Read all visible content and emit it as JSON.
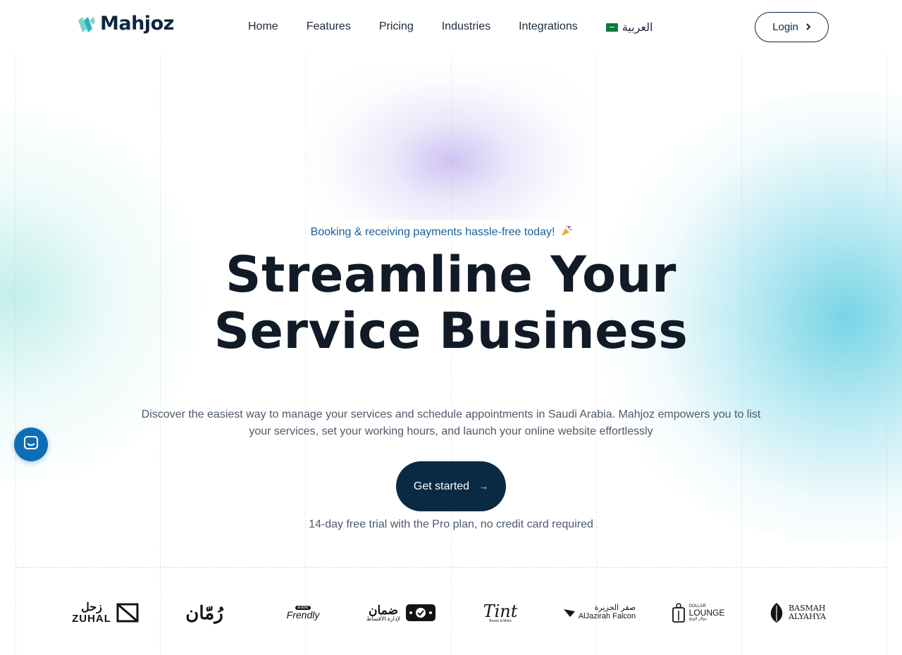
{
  "brand": {
    "name": "Mahjoz"
  },
  "nav": {
    "items": [
      {
        "label": "Home"
      },
      {
        "label": "Features"
      },
      {
        "label": "Pricing"
      },
      {
        "label": "Industries"
      },
      {
        "label": "Integrations"
      }
    ],
    "language": {
      "label": "العربية",
      "flag_icon": "saudi-flag-icon"
    },
    "login_label": "Login"
  },
  "hero": {
    "badge_text": "Booking & receiving payments hassle-free today!",
    "badge_icon": "party-popper-icon",
    "headline_line1": "Streamline Your",
    "headline_line2": "Service Business",
    "subtext": "Discover the easiest way to manage your services and schedule appointments in Saudi Arabia. Mahjoz empowers you to list your services, set your working hours, and launch your online website effortlessly",
    "cta_label": "Get started",
    "trial_note": "14-day free trial with the Pro plan, no credit card required"
  },
  "client_logos": [
    {
      "name": "ZUHAL",
      "arabic": "زحل"
    },
    {
      "name": "",
      "arabic": "رُمّان"
    },
    {
      "name": "Frendly",
      "arabic": "",
      "tag": "arabic"
    },
    {
      "name": "لإدارة الأقساط",
      "arabic": "ضمان"
    },
    {
      "name": "Tint",
      "arabic": "",
      "tag": "Brows & More"
    },
    {
      "name": "AlJazirah Falcon",
      "arabic": "صقر الجزيرة"
    },
    {
      "name": "LOUNGE",
      "arabic": "دولار لاونج",
      "tag": "DOLLAR"
    },
    {
      "name": "BASMAH",
      "arabic": "",
      "tag": "ALYAHYA"
    }
  ],
  "colors": {
    "primary": "#0a2a44",
    "link": "#1b5f9a",
    "chat": "#0d6eb5",
    "glow_cyan": "#60cde1",
    "glow_violet": "#bea fF0"
  }
}
